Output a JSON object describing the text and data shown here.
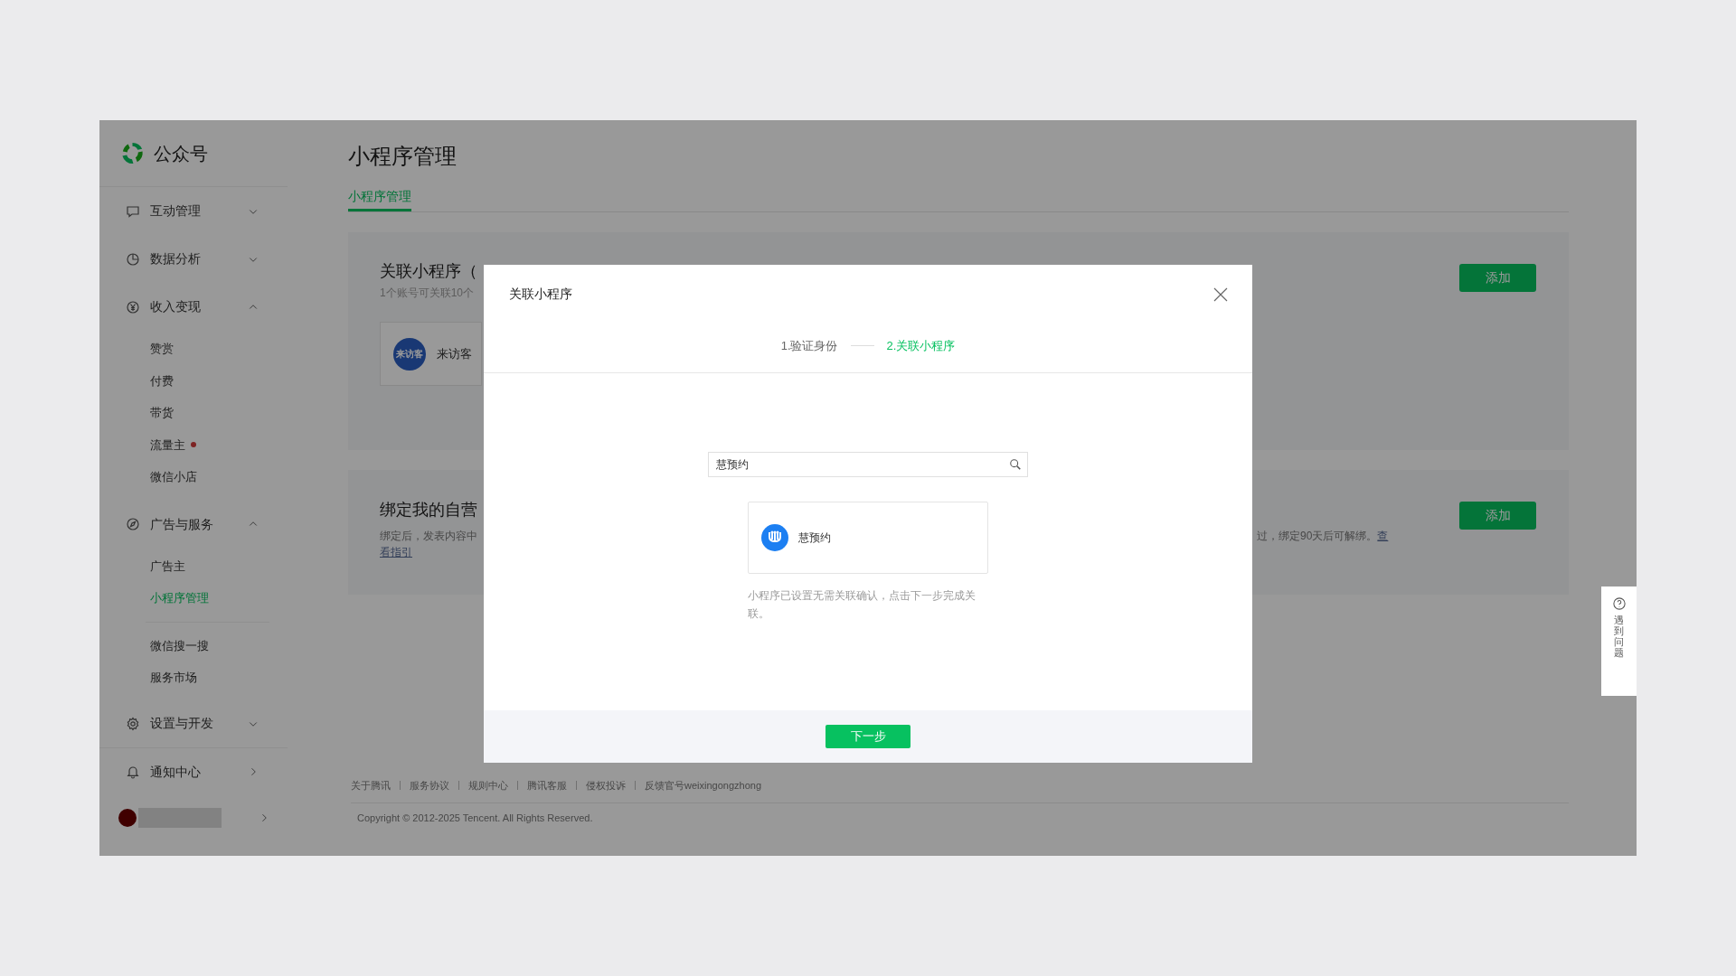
{
  "brand": {
    "name": "公众号"
  },
  "sidebar": {
    "items": [
      {
        "kind": "group",
        "label": "互动管理",
        "expanded": false
      },
      {
        "kind": "group",
        "label": "数据分析",
        "expanded": false
      },
      {
        "kind": "group",
        "label": "收入变现",
        "expanded": true,
        "children": [
          {
            "label": "赞赏",
            "selected": false,
            "dot": false,
            "separated": false
          },
          {
            "label": "付费",
            "selected": false,
            "dot": false,
            "separated": false
          },
          {
            "label": "带货",
            "selected": false,
            "dot": false,
            "separated": false
          },
          {
            "label": "流量主",
            "selected": false,
            "dot": true,
            "separated": false
          },
          {
            "label": "微信小店",
            "selected": false,
            "dot": false,
            "separated": false
          }
        ]
      },
      {
        "kind": "group",
        "label": "广告与服务",
        "expanded": true,
        "children": [
          {
            "label": "广告主",
            "selected": false,
            "dot": false,
            "separated": false
          },
          {
            "label": "小程序管理",
            "selected": true,
            "dot": false,
            "separated": false
          },
          {
            "label": "微信搜一搜",
            "selected": false,
            "dot": false,
            "separated": true
          },
          {
            "label": "服务市场",
            "selected": false,
            "dot": false,
            "separated": false
          }
        ]
      },
      {
        "kind": "group",
        "label": "设置与开发",
        "expanded": false
      },
      {
        "kind": "link",
        "label": "通知中心"
      },
      {
        "kind": "account"
      }
    ]
  },
  "main": {
    "title": "小程序管理",
    "tabs": [
      {
        "label": "小程序管理",
        "selected": true
      }
    ],
    "sections": [
      {
        "title": "关联小程序（",
        "subtitle": "1个账号可关联10个",
        "apps": [
          {
            "name": "来访客",
            "logo_text": "来访客"
          }
        ],
        "add_button": "添加"
      },
      {
        "title": "绑定我的自营",
        "description_left": "绑定后，发表内容中",
        "description_right": "过，绑定90天后可解绑。",
        "link_start": "查",
        "link_end": "看指引",
        "add_button": "添加"
      }
    ]
  },
  "footer": {
    "links": [
      "关于腾讯",
      "服务协议",
      "规则中心",
      "腾讯客服",
      "侵权投诉",
      "反馈官号weixingongzhong"
    ],
    "copyright": "Copyright © 2012-2025 Tencent. All Rights Reserved."
  },
  "modal": {
    "title": "关联小程序",
    "steps": [
      {
        "label": "1.验证身份",
        "selected": false
      },
      {
        "label": "2.关联小程序",
        "selected": true
      }
    ],
    "search": {
      "value": "慧预约"
    },
    "result": {
      "name": "慧预约"
    },
    "hint": "小程序已设置无需关联确认，点击下一步完成关联。",
    "next_button": "下一步"
  },
  "help": {
    "label": "遇到问题"
  }
}
